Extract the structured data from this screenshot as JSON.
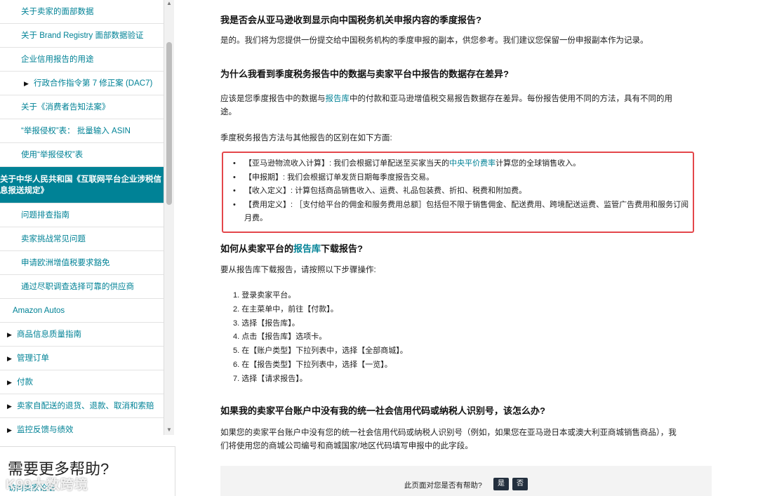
{
  "sidebar": {
    "items": [
      {
        "label": "关于卖家的面部数据",
        "level": "indent"
      },
      {
        "label": "关于 Brand Registry 面部数据验证",
        "level": "indent"
      },
      {
        "label": "企业信用报告的用途",
        "level": "indent"
      },
      {
        "label": "行政合作指令第 7 修正案 (DAC7)",
        "level": "sub-bullet"
      },
      {
        "label": "关于《消费者告知法案》",
        "level": "indent"
      },
      {
        "label": "“举报侵权”表： 批量输入 ASIN",
        "level": "indent"
      },
      {
        "label": "使用“举报侵权”表",
        "level": "indent"
      },
      {
        "label": "关于中华人民共和国《互联网平台企业涉税信息报送规定》",
        "level": "active"
      },
      {
        "label": "问题排查指南",
        "level": "indent"
      },
      {
        "label": "卖家挑战常见问题",
        "level": "indent"
      },
      {
        "label": "申请欧洲增值税要求豁免",
        "level": "indent"
      },
      {
        "label": "通过尽职调查选择可靠的供应商",
        "level": "indent"
      },
      {
        "label": "Amazon Autos",
        "level": "top"
      },
      {
        "label": "商品信息质量指南",
        "level": "bullet"
      },
      {
        "label": "管理订单",
        "level": "bullet"
      },
      {
        "label": "付款",
        "level": "bullet"
      },
      {
        "label": "卖家自配送的退货、退款、取消和索赔",
        "level": "bullet"
      },
      {
        "label": "监控反馈与绩效",
        "level": "bullet"
      }
    ],
    "help": {
      "title": "需要更多帮助?",
      "link": "访问卖家论坛"
    },
    "watermark": "K99大数跨境"
  },
  "content": {
    "q1": {
      "title": "我是否会从亚马逊收到显示向中国税务机关申报内容的季度报告?",
      "answer": "是的。我们将为您提供一份提交给中国税务机构的季度申报的副本，供您参考。我们建议您保留一份申报副本作为记录。"
    },
    "q2": {
      "title": "为什么我看到季度税务报告中的数据与卖家平台中报告的数据存在差异?",
      "p1_before": "应该是您季度报告中的数据与",
      "p1_link": "报告库",
      "p1_after": "中的付款和亚马逊增值税交易报告数据存在差异。每份报告使用不同的方法，具有不同的用途。",
      "p2": "季度税务报告方法与其他报告的区别在如下方面:",
      "bullets": [
        {
          "before": "【亚马逊物流收入计算】: 我们会根据订单配送至买家当天的",
          "link": "中央平价费率",
          "after": "计算您的全球销售收入。"
        },
        {
          "before": "【申报期】: 我们会根据订单发货日期每季度报告交易。",
          "link": "",
          "after": ""
        },
        {
          "before": "【收入定义】: 计算包括商品销售收入、运费、礼品包装费、折扣、税费和附加费。",
          "link": "",
          "after": ""
        },
        {
          "before": "【费用定义】: ［支付给平台的佣金和服务费用总额］包括但不限于销售佣金、配送费用、跨境配送运费、监管广告费用和服务订阅月费。",
          "link": "",
          "after": ""
        }
      ]
    },
    "q3": {
      "title_before": "如何从卖家平台的",
      "title_link": "报告库",
      "title_after": "下载报告?",
      "intro": "要从报告库下载报告，请按照以下步骤操作:",
      "steps": [
        "1. 登录卖家平台。",
        "2. 在主菜单中，前往【付款】。",
        "3. 选择【报告库】。",
        "4. 点击【报告库】选项卡。",
        "5. 在【账户类型】下拉列表中，选择【全部商城】。",
        "6. 在【报告类型】下拉列表中，选择【一览】。",
        "7. 选择【请求报告】。"
      ]
    },
    "q4": {
      "title": "如果我的卖家平台账户中没有我的统一社会信用代码或纳税人识别号，该怎么办?",
      "answer": "如果您的卖家平台账户中没有您的统一社会信用代码或纳税人识别号（例如，如果您在亚马逊日本或澳大利亚商城销售商品），我们将使用您的商城公司编号和商城国家/地区代码填写申报中的此字段。"
    },
    "feedback": {
      "question": "此页面对您是否有帮助?",
      "yes": "是",
      "no": "否"
    }
  },
  "colors": {
    "link": "#008296",
    "active_bg": "#008296",
    "highlight_border": "#e4474b",
    "button_bg": "#232f3e"
  }
}
